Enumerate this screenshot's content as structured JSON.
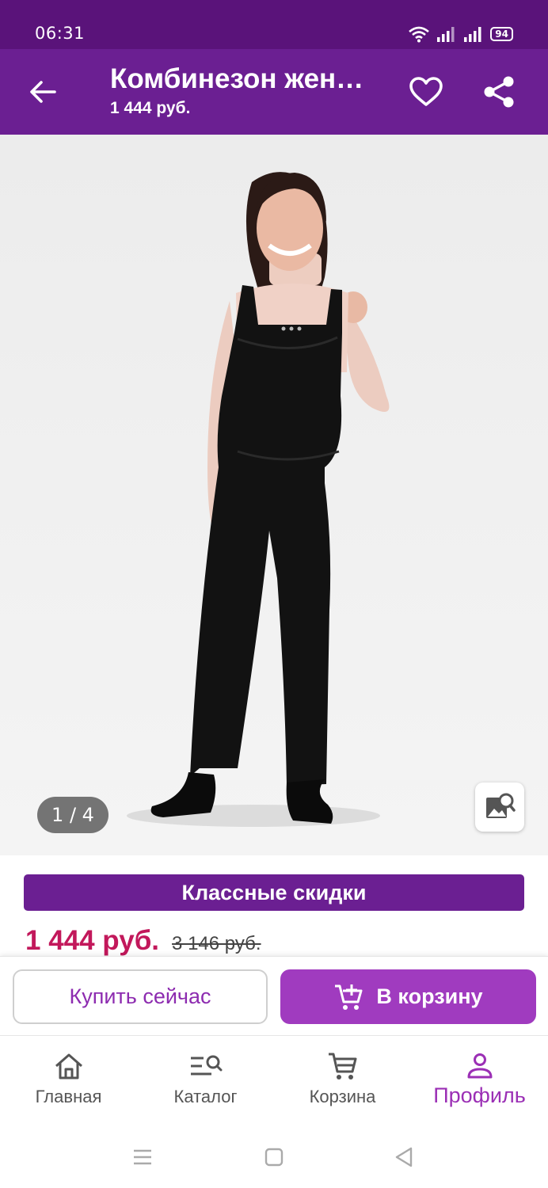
{
  "status_bar": {
    "time": "06:31",
    "battery": "94"
  },
  "header": {
    "title": "Комбинезон жен…",
    "price": "1 444 руб."
  },
  "gallery": {
    "counter": "1 / 4"
  },
  "promo": {
    "label": "Классные скидки"
  },
  "price": {
    "current": "1 444 руб.",
    "old": "3 146 руб."
  },
  "actions": {
    "buy_now": "Купить сейчас",
    "add_to_cart": "В корзину"
  },
  "bottom_nav": {
    "items": [
      {
        "label": "Главная",
        "icon": "home-icon"
      },
      {
        "label": "Каталог",
        "icon": "catalog-search-icon"
      },
      {
        "label": "Корзина",
        "icon": "cart-icon"
      },
      {
        "label": "Профиль",
        "icon": "profile-icon",
        "active": true
      }
    ]
  },
  "colors": {
    "header": "#6b1f92",
    "status_bar": "#5a137a",
    "accent": "#a03bbf",
    "price": "#c2185b"
  }
}
